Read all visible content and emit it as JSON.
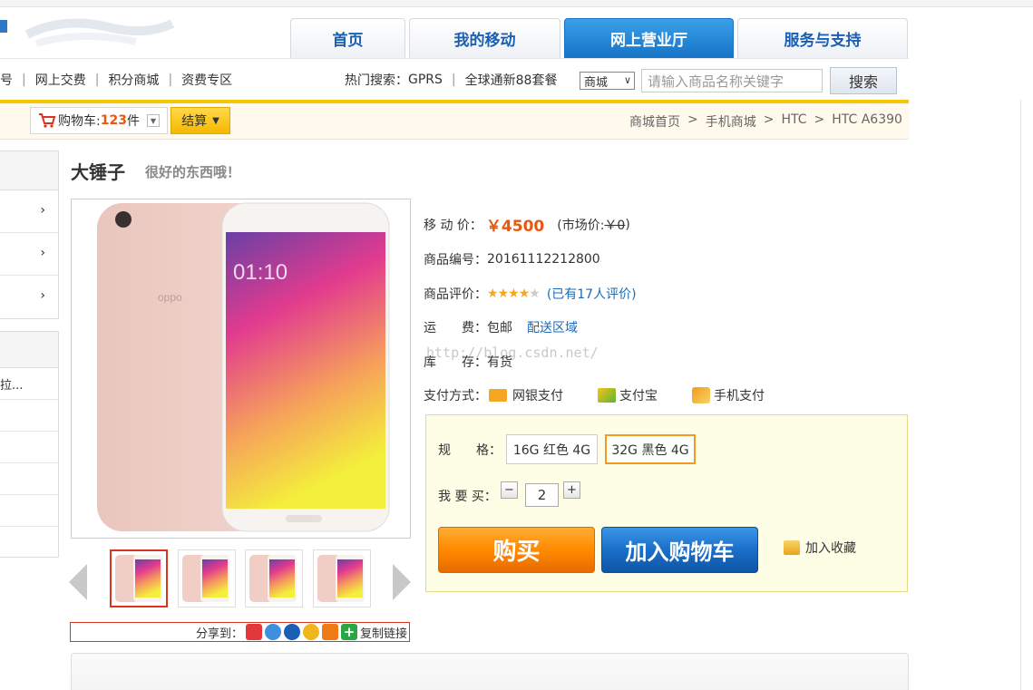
{
  "nav": {
    "tabs": [
      {
        "label": "首页"
      },
      {
        "label": "我的移动"
      },
      {
        "label": "网上营业厅"
      },
      {
        "label": "服务与支持"
      }
    ]
  },
  "subnav": {
    "links": [
      "选号",
      "网上交费",
      "积分商城",
      "资费专区"
    ],
    "hot_label": "热门搜索：",
    "hot_items": [
      "GPRS",
      "全球通新88套餐"
    ],
    "search_scope": "商城",
    "search_placeholder": "请输入商品名称关键字",
    "search_button": "搜索"
  },
  "cart": {
    "label": "购物车:",
    "count": "123",
    "unit": "件",
    "checkout": "结算"
  },
  "breadcrumb": [
    "商城首页",
    ">",
    "手机商城",
    ">",
    "HTC",
    ">",
    "HTC A6390"
  ],
  "product": {
    "title": "大锤子",
    "subtitle": "很好的东西哦！",
    "price_label": "移 动 价：",
    "price": "￥4500",
    "market_price_prefix": "(市场价:",
    "market_price": "￥0",
    "market_price_suffix": ")",
    "code_label": "商品编号：",
    "code": "20161112212800",
    "rating_label": "商品评价：",
    "rating_stars": 3.5,
    "rating_link": "(已有17人评价)",
    "shipping_label": "运　　费：",
    "shipping": "包邮",
    "shipping_link": "配送区域",
    "stock_label": "库　　存：",
    "stock": "有货",
    "pay_label": "支付方式：",
    "pay_methods": [
      "网银支付",
      "支付宝",
      "手机支付"
    ],
    "watermark": "http://blog.csdn.net/"
  },
  "spec": {
    "label": "规　　格：",
    "options": [
      "16G 红色 4G",
      "32G 黑色 4G"
    ],
    "selected_index": 1,
    "qty_label": "我 要 买：",
    "qty": "2",
    "minus": "−",
    "plus": "+",
    "buy": "购买",
    "add_cart": "加入购物车",
    "favorite": "加入收藏"
  },
  "share": {
    "label": "分享到：",
    "copy_link": "复制链接"
  },
  "sidebar": {
    "partial_item": "拉..."
  },
  "colors": {
    "accent_orange": "#e8570e",
    "nav_active": "#1673c6",
    "link_blue": "#1a6bb8",
    "gold_bar": "#f7c600"
  }
}
